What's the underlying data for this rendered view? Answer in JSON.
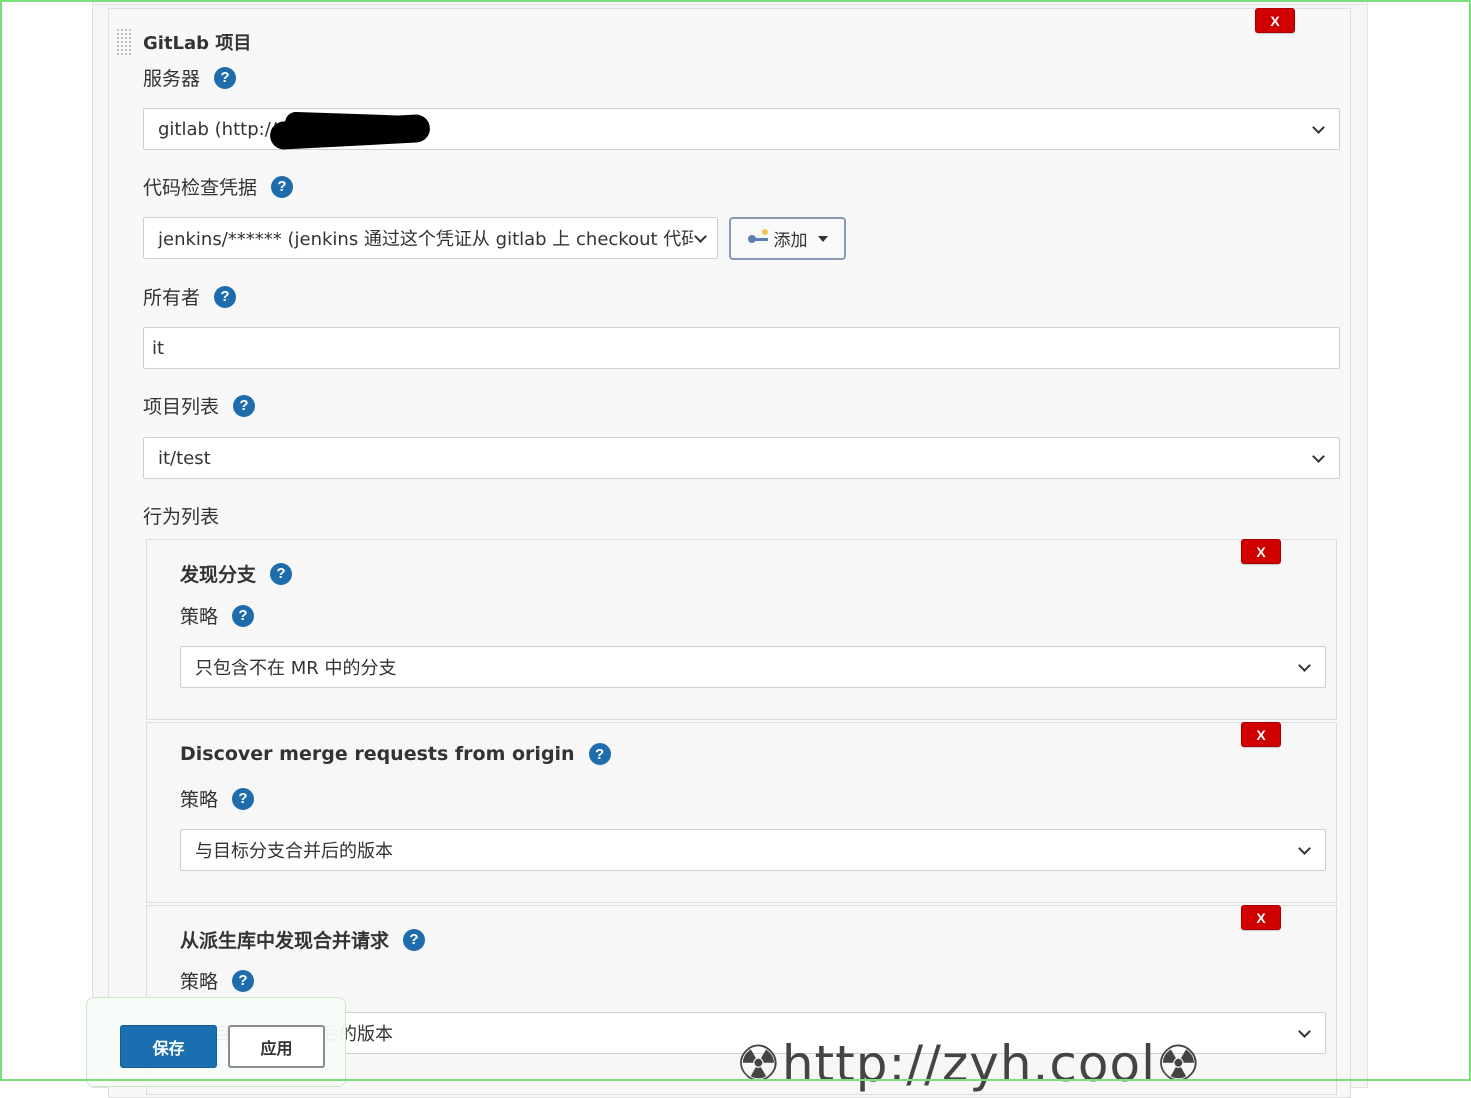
{
  "gitlab_project": {
    "title": "GitLab 项目",
    "delete_label": "X",
    "server": {
      "label": "服务器",
      "help": "?",
      "value": "gitlab (http://",
      "value_suffix": ")"
    },
    "credentials": {
      "label": "代码检查凭据",
      "help": "?",
      "value": "jenkins/****** (jenkins 通过这个凭证从 gitlab 上 checkout 代码)",
      "add_label": "添加"
    },
    "owner": {
      "label": "所有者",
      "help": "?",
      "value": "it"
    },
    "projects": {
      "label": "项目列表",
      "help": "?",
      "value": "it/test"
    },
    "behaviors_label": "行为列表"
  },
  "behaviors": [
    {
      "title": "发现分支",
      "help": "?",
      "strategy_label": "策略",
      "strategy_help": "?",
      "strategy_value": "只包含不在 MR 中的分支",
      "delete_label": "X"
    },
    {
      "title": "Discover merge requests from origin",
      "help": "?",
      "strategy_label": "策略",
      "strategy_help": "?",
      "strategy_value": "与目标分支合并后的版本",
      "delete_label": "X"
    },
    {
      "title": "从派生库中发现合并请求",
      "help": "?",
      "strategy_label": "策略",
      "strategy_help": "?",
      "strategy_value": "与目标分支合并后的版本",
      "delete_label": "X"
    }
  ],
  "footer": {
    "save_label": "保存",
    "apply_label": "应用"
  },
  "watermark": "☢http://zyh.cool☢",
  "colors": {
    "help_icon": "#1f6cad",
    "delete_button": "#d00000",
    "save_button": "#1a6fb0",
    "frame": "#7be07b"
  }
}
